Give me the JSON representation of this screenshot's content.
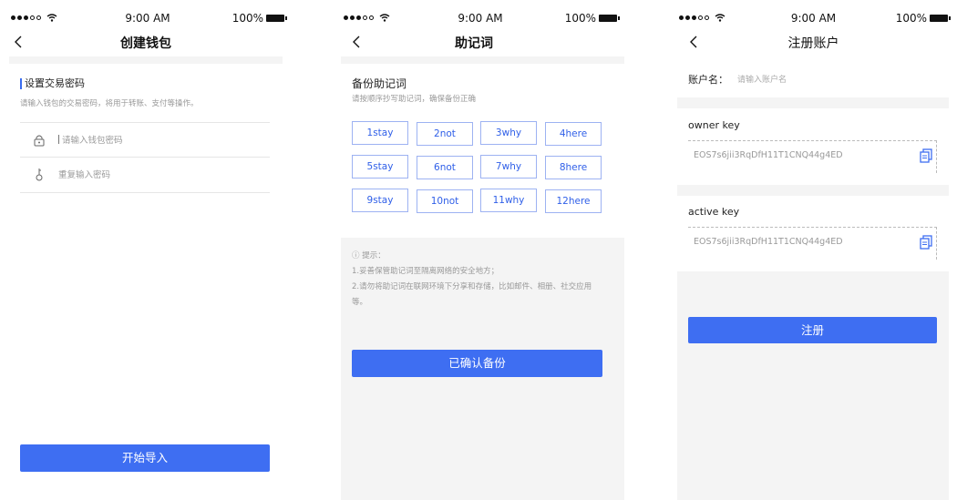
{
  "status_bar": {
    "time": "9:00 AM",
    "battery": "100%"
  },
  "screens": {
    "create_wallet": {
      "title": "创建钱包",
      "section_title": "设置交易密码",
      "section_desc": "请输入钱包的交易密码，将用于转账、支付等操作。",
      "password_placeholder": "请输入钱包密码",
      "repeat_placeholder": "重复输入密码",
      "start_import_button": "开始导入"
    },
    "mnemonic": {
      "title": "助记词",
      "backup_title": "备份助记词",
      "backup_desc": "请按顺序抄写助记词，确保备份正确",
      "words": [
        "1stay",
        "2not",
        "3why",
        "4here",
        "5stay",
        "6not",
        "7why",
        "8here",
        "9stay",
        "10not",
        "11why",
        "12here"
      ],
      "tips": {
        "heading": "ⓘ 提示：",
        "line1": "1.妥善保管助记词至隔离网络的安全地方；",
        "line2": "2.请勿将助记词在联网环境下分享和存储，比如邮件、相册、社交应用等。"
      },
      "confirm_button": "已确认备份"
    },
    "register": {
      "title": "注册账户",
      "account_label": "账户名：",
      "account_placeholder": "请输入账户名",
      "owner_key_label": "owner key",
      "owner_key_value": "EOS7s6jii3RqDfH11T1CNQ44g4ED",
      "active_key_label": "active key",
      "active_key_value": "EOS7s6jii3RqDfH11T1CNQ44g4ED",
      "register_button": "注册"
    }
  },
  "colors": {
    "accent": "#3e6ef2",
    "word_border": "#9db2f2",
    "word_text": "#2f5fe8",
    "panel_bg": "#f4f4f4"
  },
  "icons": [
    "back-icon",
    "lock-icon",
    "key-icon",
    "copy-icon",
    "wifi-icon",
    "battery-icon",
    "signal-icon"
  ]
}
